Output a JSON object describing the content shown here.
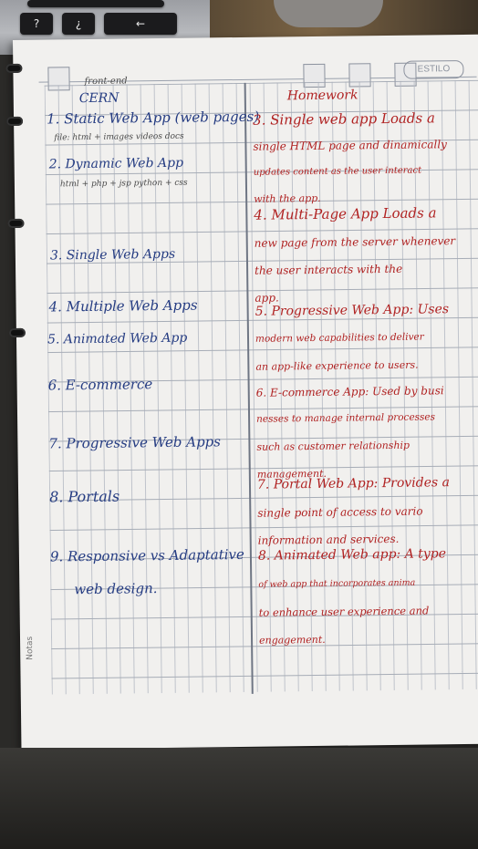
{
  "keyboard": {
    "keys": [
      "?",
      "¿",
      "←"
    ]
  },
  "header": {
    "brand": "ESTILO"
  },
  "left_column": {
    "top_notes": [
      "front-end",
      "CERN"
    ],
    "items": [
      {
        "text": "1. Static Web App (web pages)",
        "sub": "file: html + images videos docs"
      },
      {
        "text": "2. Dynamic Web App",
        "sub": "html + php + jsp   python + css"
      },
      {
        "text": "3. Single Web Apps"
      },
      {
        "text": "4. Multiple Web Apps"
      },
      {
        "text": "5. Animated Web App"
      },
      {
        "text": "6. E-commerce"
      },
      {
        "text": "7. Progressive Web Apps"
      },
      {
        "text": "8. Portals"
      },
      {
        "text": "9. Responsive vs Adaptative",
        "sub2": "web design."
      }
    ]
  },
  "right_column": {
    "title": "Homework",
    "lines": [
      "3. Single web app Loads a",
      "single HTML page and dinamically",
      "updates content as the user interact",
      "with the app.",
      "4. Multi-Page App Loads a",
      "new page from the server whenever",
      "the user interacts with the",
      "app.",
      "5. Progressive Web App: Uses",
      "modern web capabilities to deliver",
      "an app-like experience to users.",
      "6. E-commerce App: Used by busi",
      "nesses to manage internal processes",
      "such as customer relationship",
      "management.",
      "7. Portal Web App: Provides a",
      "single point of access to vario",
      "information and services.",
      "8. Animated Web app: A type",
      "of web app that incorporates anima",
      "to enhance user experience and",
      "engagement."
    ]
  },
  "footer": {
    "notes_label": "Notas"
  }
}
